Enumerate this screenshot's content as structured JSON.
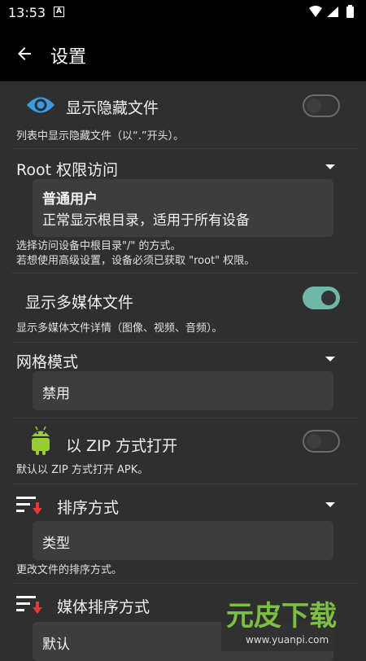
{
  "statusbar": {
    "time": "13:53",
    "notif_badge": "A",
    "sys_icons": "▼◢▮"
  },
  "appbar": {
    "title": "设置"
  },
  "hidden_files": {
    "title": "显示隐藏文件",
    "desc": "列表中显示隐藏文件（以“.”开头）。",
    "enabled": false
  },
  "root_access": {
    "title": "Root 权限访问",
    "selected_title": "普通用户",
    "selected_desc": "正常显示根目录，适用于所有设备",
    "desc_line1": "选择访问设备中根目录\"/\" 的方式。",
    "desc_line2": "若想使用高级设置，设备必须已获取 \"root\" 权限。"
  },
  "media_files": {
    "title": "显示多媒体文件",
    "desc": "显示多媒体文件详情（图像、视频、音频）。",
    "enabled": true
  },
  "grid_mode": {
    "title": "网格模式",
    "value": "禁用"
  },
  "zip_open": {
    "title": "以 ZIP 方式打开",
    "desc": "默认以 ZIP 方式打开 APK。",
    "enabled": false
  },
  "sort_mode": {
    "title": "排序方式",
    "value": "类型",
    "desc": "更改文件的排序方式。"
  },
  "media_sort": {
    "title": "媒体排序方式",
    "value": "默认"
  },
  "watermark": {
    "brand": "元皮下载",
    "url": "www.yuanpi.com"
  },
  "colors": {
    "accent": "#6fb8a8",
    "eye_icon": "#3a9be0",
    "android": "#9acd32",
    "sort_arrow": "#e53935"
  }
}
